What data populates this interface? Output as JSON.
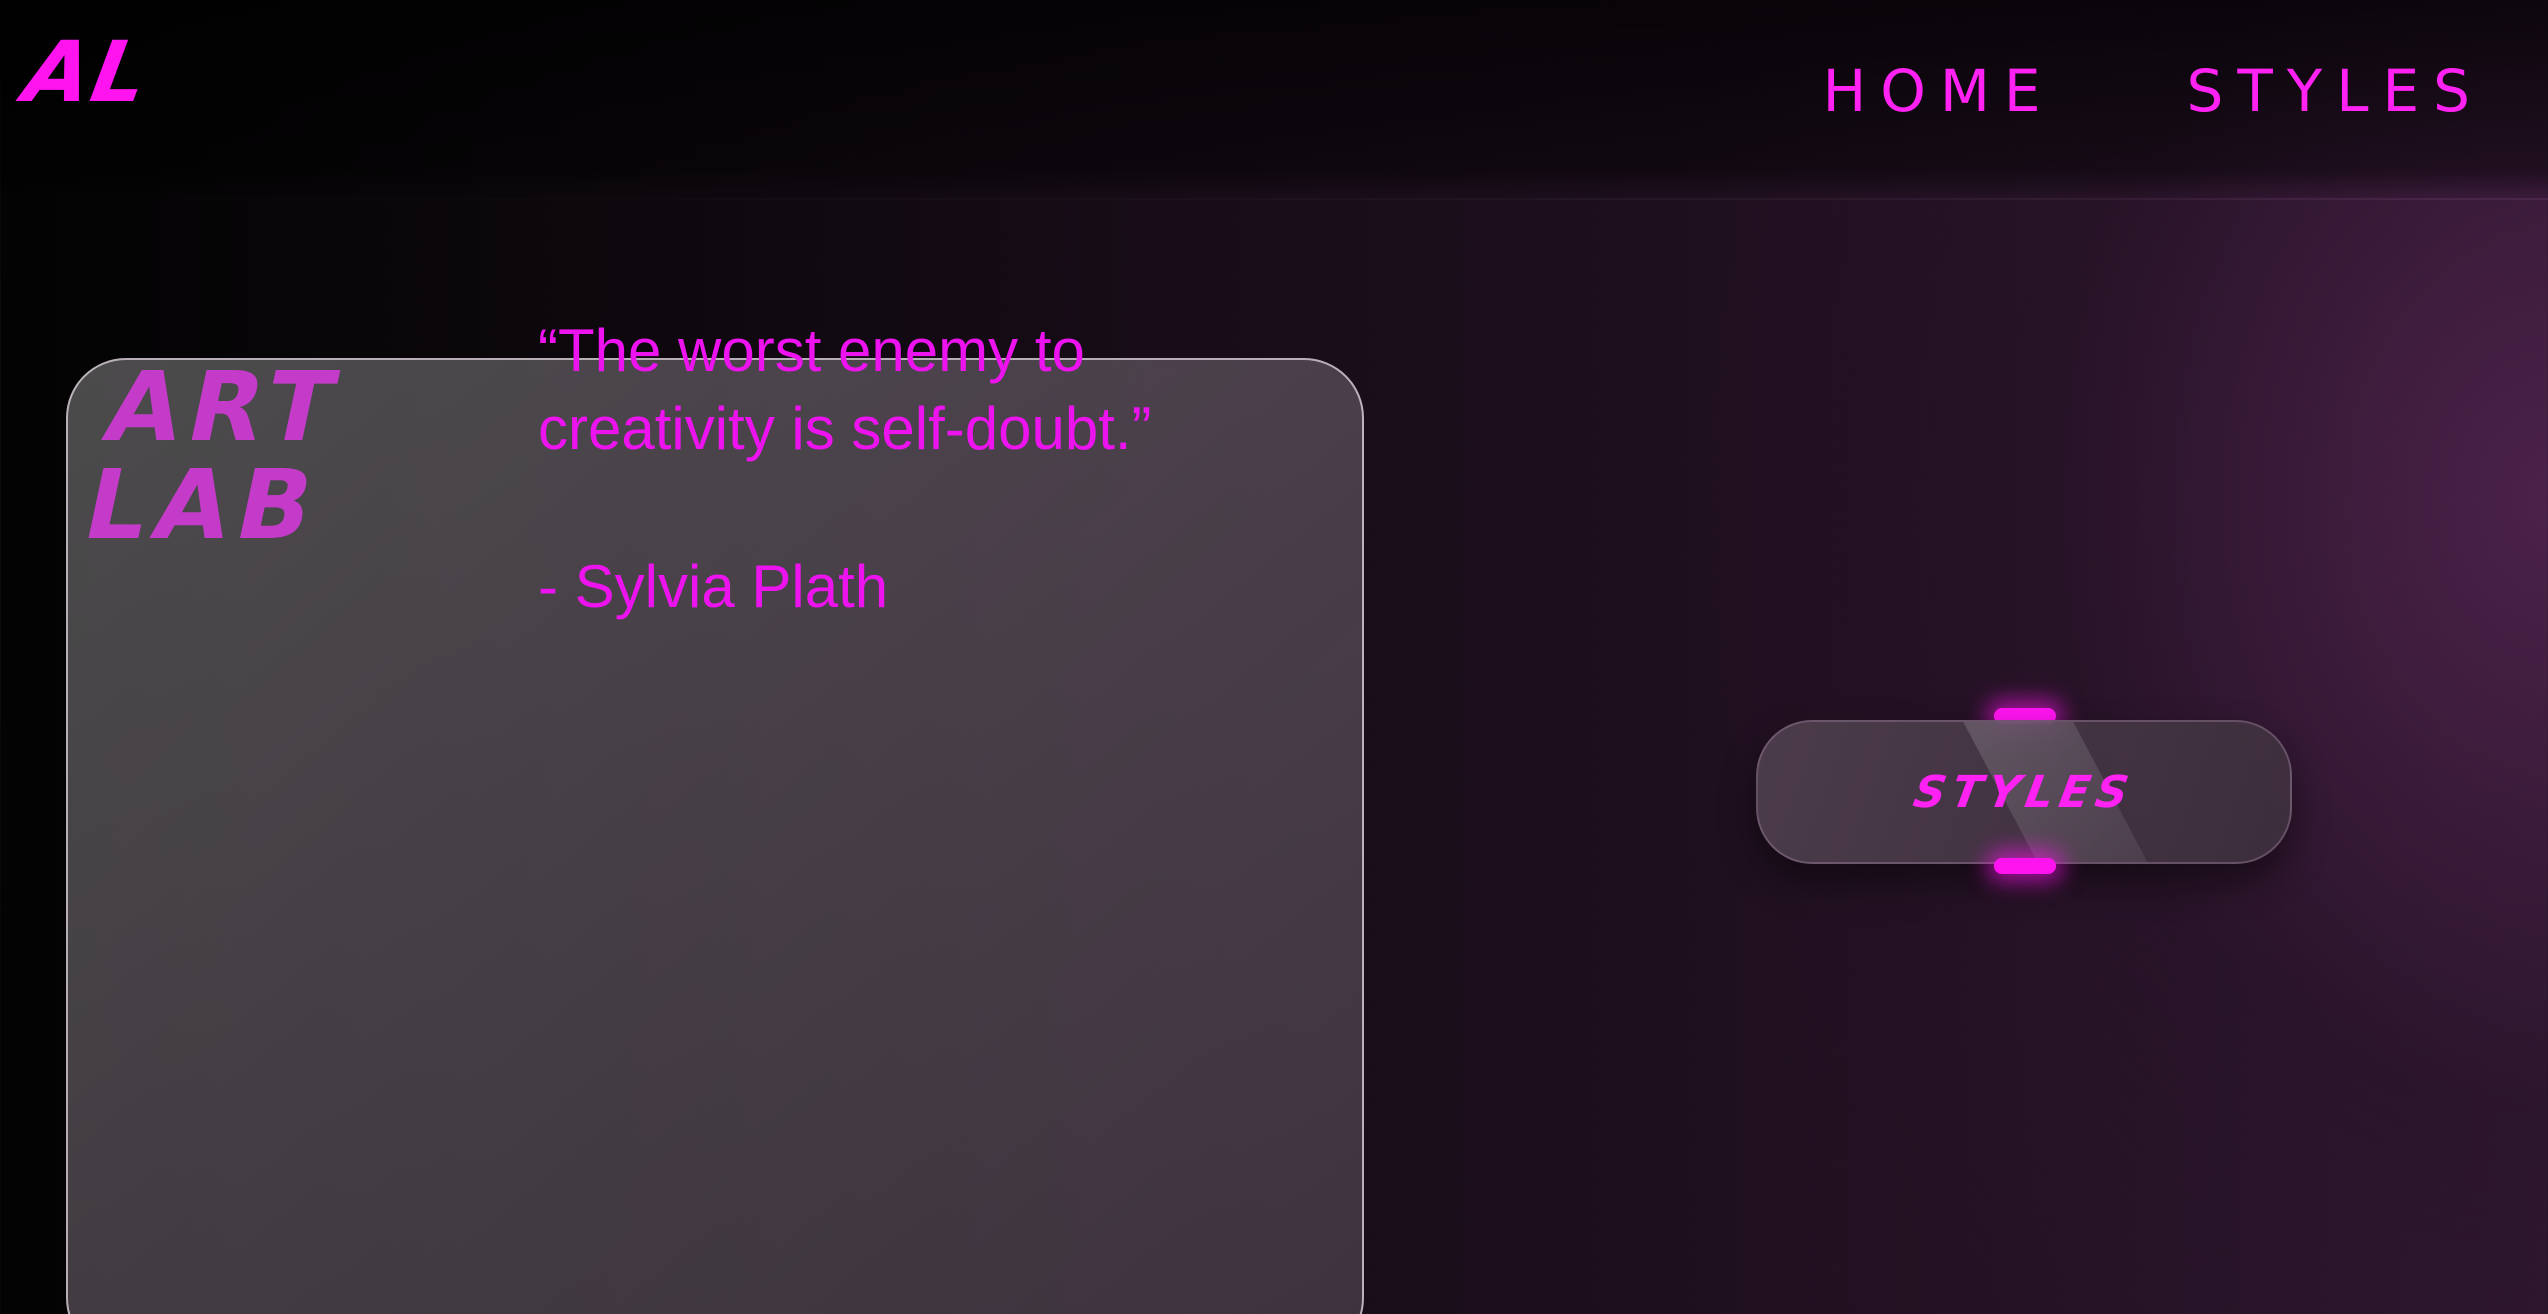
{
  "header": {
    "logo": "AL",
    "nav": [
      {
        "label": "HOME"
      },
      {
        "label": "STYLES"
      }
    ]
  },
  "card": {
    "brand_line1": "ART",
    "brand_line2": "LAB",
    "quote": "“The worst enemy to creativity is self-doubt.”",
    "author": "- Sylvia Plath"
  },
  "cta": {
    "label": "STYLES"
  },
  "colors": {
    "accent": "#ff14f0",
    "brand_text": "#c53bc9",
    "background_dark": "#030303",
    "background_purple": "#2f1830"
  }
}
